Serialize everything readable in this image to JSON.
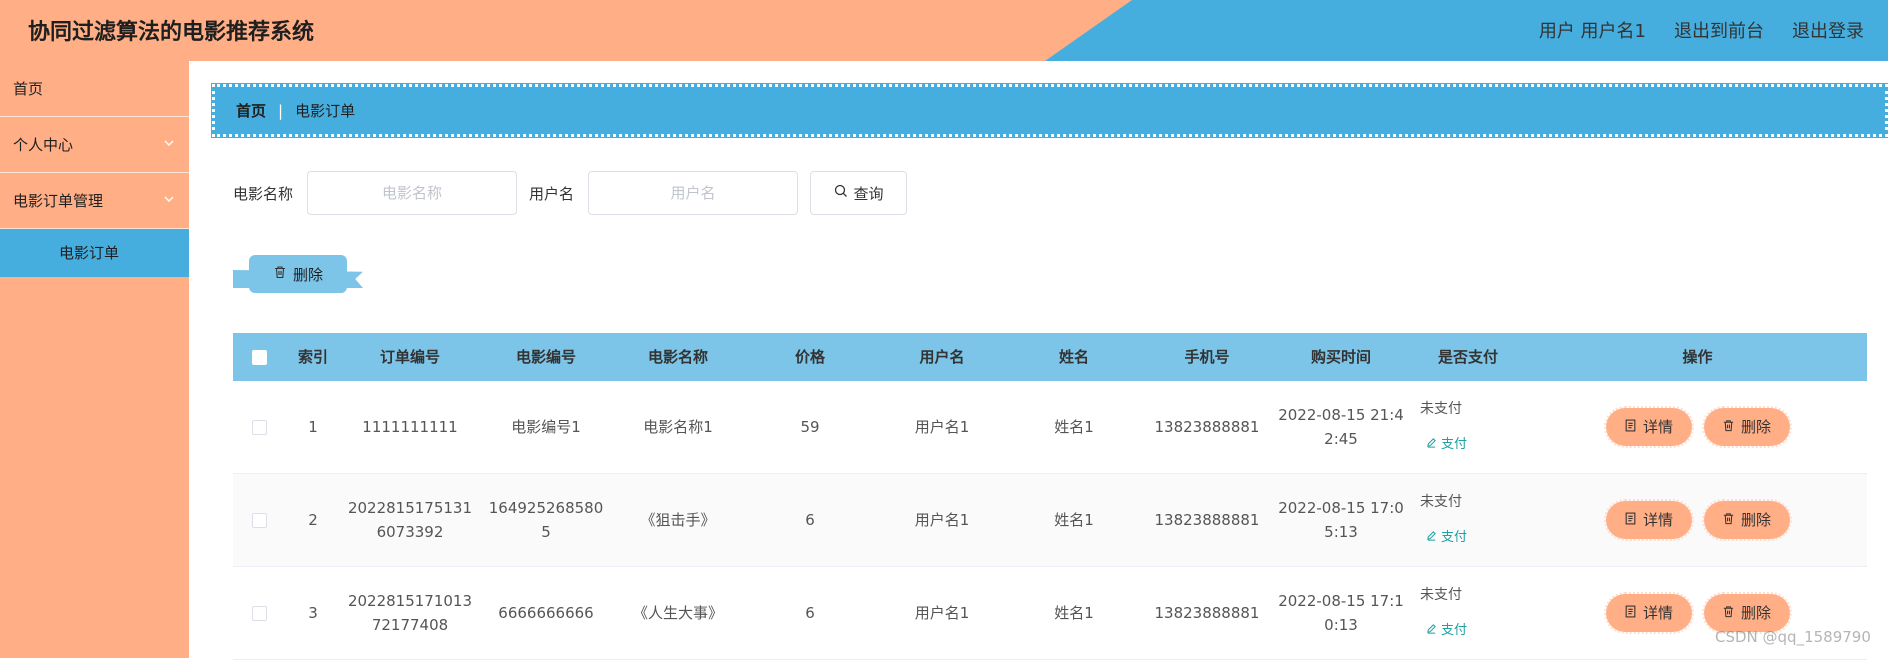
{
  "header": {
    "title": "协同过滤算法的电影推荐系统",
    "user_text": "用户 用户名1",
    "back_to_front": "退出到前台",
    "logout": "退出登录"
  },
  "sidebar": {
    "items": [
      {
        "label": "首页"
      },
      {
        "label": "个人中心",
        "icon": "chevron-down-icon"
      },
      {
        "label": "电影订单管理",
        "icon": "chevron-down-icon"
      }
    ],
    "active_sub": "电影订单"
  },
  "breadcrumb": {
    "home": "首页",
    "separator": "|",
    "current": "电影订单"
  },
  "search": {
    "movie_label": "电影名称",
    "movie_placeholder": "电影名称",
    "user_label": "用户名",
    "user_placeholder": "用户名",
    "query_label": "查询"
  },
  "toolbar": {
    "delete_label": "删除"
  },
  "table": {
    "columns": [
      "索引",
      "订单编号",
      "电影编号",
      "电影名称",
      "价格",
      "用户名",
      "姓名",
      "手机号",
      "购买时间",
      "是否支付",
      "操作"
    ],
    "rows": [
      {
        "index": "1",
        "order_no": "1111111111",
        "movie_no": "电影编号1",
        "movie_name": "电影名称1",
        "price": "59",
        "username": "用户名1",
        "name": "姓名1",
        "phone": "13823888881",
        "buy_time": "2022-08-15 21:42:45",
        "pay_status": "未支付",
        "pay_action": "支付",
        "detail": "详情",
        "delete": "删除"
      },
      {
        "index": "2",
        "order_no": "20228151751316073392",
        "movie_no": "1649252685805",
        "movie_name": "《狙击手》",
        "price": "6",
        "username": "用户名1",
        "name": "姓名1",
        "phone": "13823888881",
        "buy_time": "2022-08-15 17:05:13",
        "pay_status": "未支付",
        "pay_action": "支付",
        "detail": "详情",
        "delete": "删除"
      },
      {
        "index": "3",
        "order_no": "202281517101372177408",
        "movie_no": "6666666666",
        "movie_name": "《人生大事》",
        "price": "6",
        "username": "用户名1",
        "name": "姓名1",
        "phone": "13823888881",
        "buy_time": "2022-08-15 17:10:13",
        "pay_status": "未支付",
        "pay_action": "支付",
        "detail": "详情",
        "delete": "删除"
      }
    ]
  },
  "watermark": "CSDN @qq_1589790"
}
